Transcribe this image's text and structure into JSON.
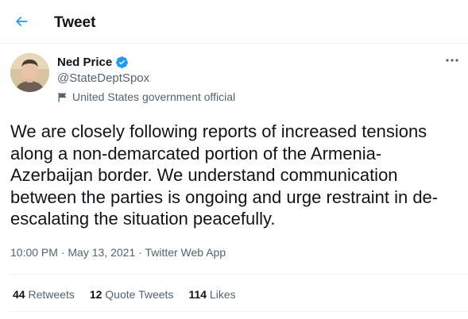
{
  "header": {
    "title": "Tweet",
    "back_icon": "arrow-left-icon"
  },
  "author": {
    "name": "Ned Price",
    "handle": "@StateDeptSpox",
    "label": "United States government official",
    "verified_icon": "verified-badge-icon",
    "label_icon": "flag-icon"
  },
  "tweet": {
    "text": "We are closely following reports of increased tensions along a non-demarcated portion of the Armenia-Azerbaijan border. We understand communication between the parties is ongoing and urge restraint in de-escalating the situation peacefully.",
    "time": "10:00 PM",
    "date": "May 13, 2021",
    "source": "Twitter Web App",
    "separator": "·"
  },
  "stats": {
    "retweets_count": "44",
    "retweets_label": "Retweets",
    "quotes_count": "12",
    "quotes_label": "Quote Tweets",
    "likes_count": "114",
    "likes_label": "Likes"
  },
  "colors": {
    "accent": "#1d9bf0",
    "text_primary": "#0f1419",
    "text_secondary": "#536471",
    "divider": "#eff3f4"
  }
}
